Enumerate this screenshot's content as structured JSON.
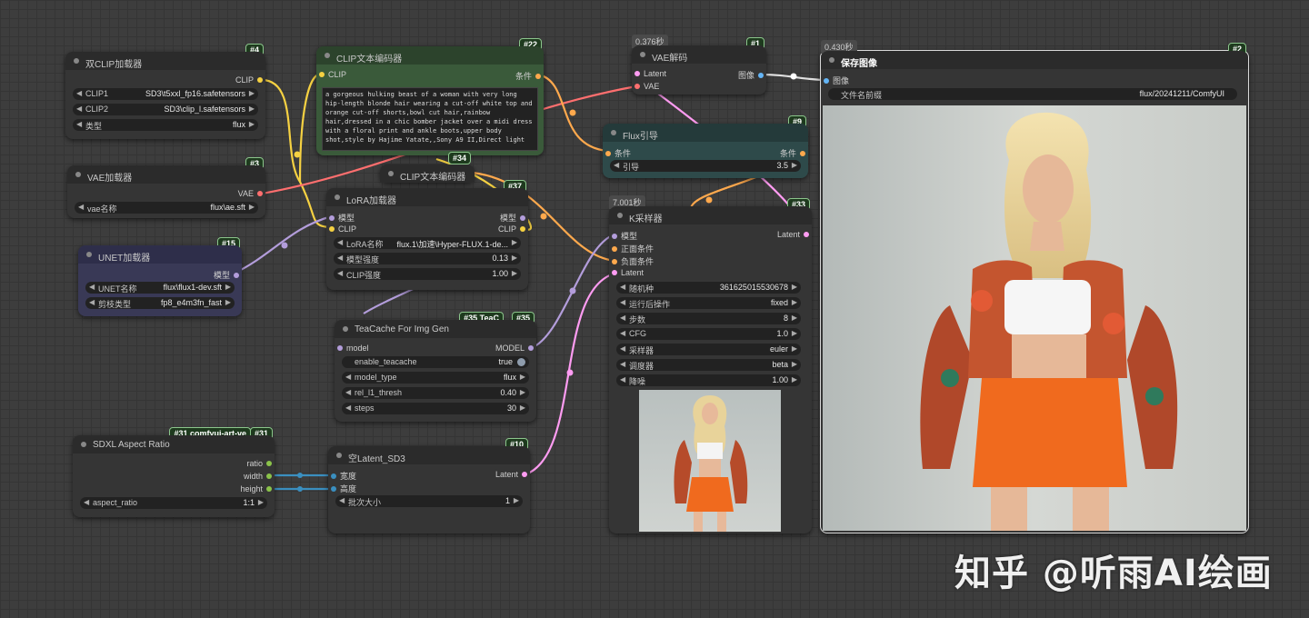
{
  "watermark": "知乎 @听雨AI绘画",
  "nodes": {
    "dual_clip": {
      "id": "#4",
      "title": "双CLIP加载器",
      "out": "CLIP",
      "w": [
        {
          "label": "CLIP1",
          "value": "SD3\\t5xxl_fp16.safetensors"
        },
        {
          "label": "CLIP2",
          "value": "SD3\\clip_l.safetensors"
        },
        {
          "label": "类型",
          "value": "flux"
        }
      ]
    },
    "vae_loader": {
      "id": "#3",
      "title": "VAE加载器",
      "out": "VAE",
      "w": [
        {
          "label": "vae名称",
          "value": "flux\\ae.sft"
        }
      ]
    },
    "unet": {
      "id": "#15",
      "title": "UNET加载器",
      "out": "模型",
      "w": [
        {
          "label": "UNET名称",
          "value": "flux\\flux1-dev.sft"
        },
        {
          "label": "剪枝类型",
          "value": "fp8_e4m3fn_fast"
        }
      ]
    },
    "clip_enc1": {
      "id": "#22",
      "title": "CLIP文本编码器",
      "in": "CLIP",
      "out": "条件",
      "text": "a gorgeous hulking beast of a woman with very long hip-length blonde hair wearing a cut-off white top and orange cut-off shorts,bowl cut hair,rainbow hair,dressed in a chic bomber jacket over a midi dress with a floral print and ankle boots,upper body shot,style by Hajime Yatate,,Sony A9 II,Direct light"
    },
    "clip_enc2": {
      "id": "#34",
      "title": "CLIP文本编码器"
    },
    "lora": {
      "id": "#37",
      "title": "LoRA加载器",
      "in1": "模型",
      "in2": "CLIP",
      "out1": "模型",
      "out2": "CLIP",
      "w": [
        {
          "label": "LoRA名称",
          "value": "flux.1\\加速\\Hyper-FLUX.1-de..."
        },
        {
          "label": "模型强度",
          "value": "0.13"
        },
        {
          "label": "CLIP强度",
          "value": "1.00"
        }
      ]
    },
    "teacache": {
      "id": "#35",
      "id_label": "#35 TeaC",
      "title": "TeaCache For Img Gen",
      "in": "model",
      "out": "MODEL",
      "w": [
        {
          "label": "enable_teacache",
          "value": "true"
        },
        {
          "label": "model_type",
          "value": "flux"
        },
        {
          "label": "rel_l1_thresh",
          "value": "0.40"
        },
        {
          "label": "steps",
          "value": "30"
        }
      ]
    },
    "sdxl": {
      "id": "#31",
      "id_label": "#31 comfyui-art-ve",
      "title": "SDXL Aspect Ratio",
      "outs": [
        "ratio",
        "width",
        "height"
      ],
      "w": [
        {
          "label": "aspect_ratio",
          "value": "1:1"
        }
      ]
    },
    "latent": {
      "id": "#10",
      "title": "空Latent_SD3",
      "ins": [
        "宽度",
        "高度"
      ],
      "out": "Latent",
      "w": [
        {
          "label": "批次大小",
          "value": "1"
        }
      ]
    },
    "vae_decode": {
      "id": "#1",
      "time": "0.376秒",
      "title": "VAE解码",
      "ins": [
        "Latent",
        "VAE"
      ],
      "out": "图像"
    },
    "flux_guide": {
      "id": "#9",
      "title": "Flux引导",
      "in": "条件",
      "out": "条件",
      "w": [
        {
          "label": "引导",
          "value": "3.5"
        }
      ]
    },
    "ksampler": {
      "id": "#33",
      "time": "7.001秒",
      "title": "K采样器",
      "ins": [
        "模型",
        "正面条件",
        "负面条件",
        "Latent"
      ],
      "out": "Latent",
      "w": [
        {
          "label": "随机种",
          "value": "361625015530678"
        },
        {
          "label": "运行后操作",
          "value": "fixed"
        },
        {
          "label": "步数",
          "value": "8"
        },
        {
          "label": "CFG",
          "value": "1.0"
        },
        {
          "label": "采样器",
          "value": "euler"
        },
        {
          "label": "调度器",
          "value": "beta"
        },
        {
          "label": "降噪",
          "value": "1.00"
        }
      ]
    },
    "save": {
      "id": "#2",
      "time": "0.430秒",
      "title": "保存图像",
      "in": "图像",
      "w": [
        {
          "label": "文件名前缀",
          "value": "flux/20241211/ComfyUI"
        }
      ]
    }
  },
  "colors": {
    "clip": "#f5d142",
    "vae": "#ff6f6f",
    "model": "#b39ddb",
    "cond": "#ffa94d",
    "latent": "#ff9cf2",
    "image": "#64b5f6",
    "int": "#8bc34a",
    "width": "#3a8fc0"
  }
}
